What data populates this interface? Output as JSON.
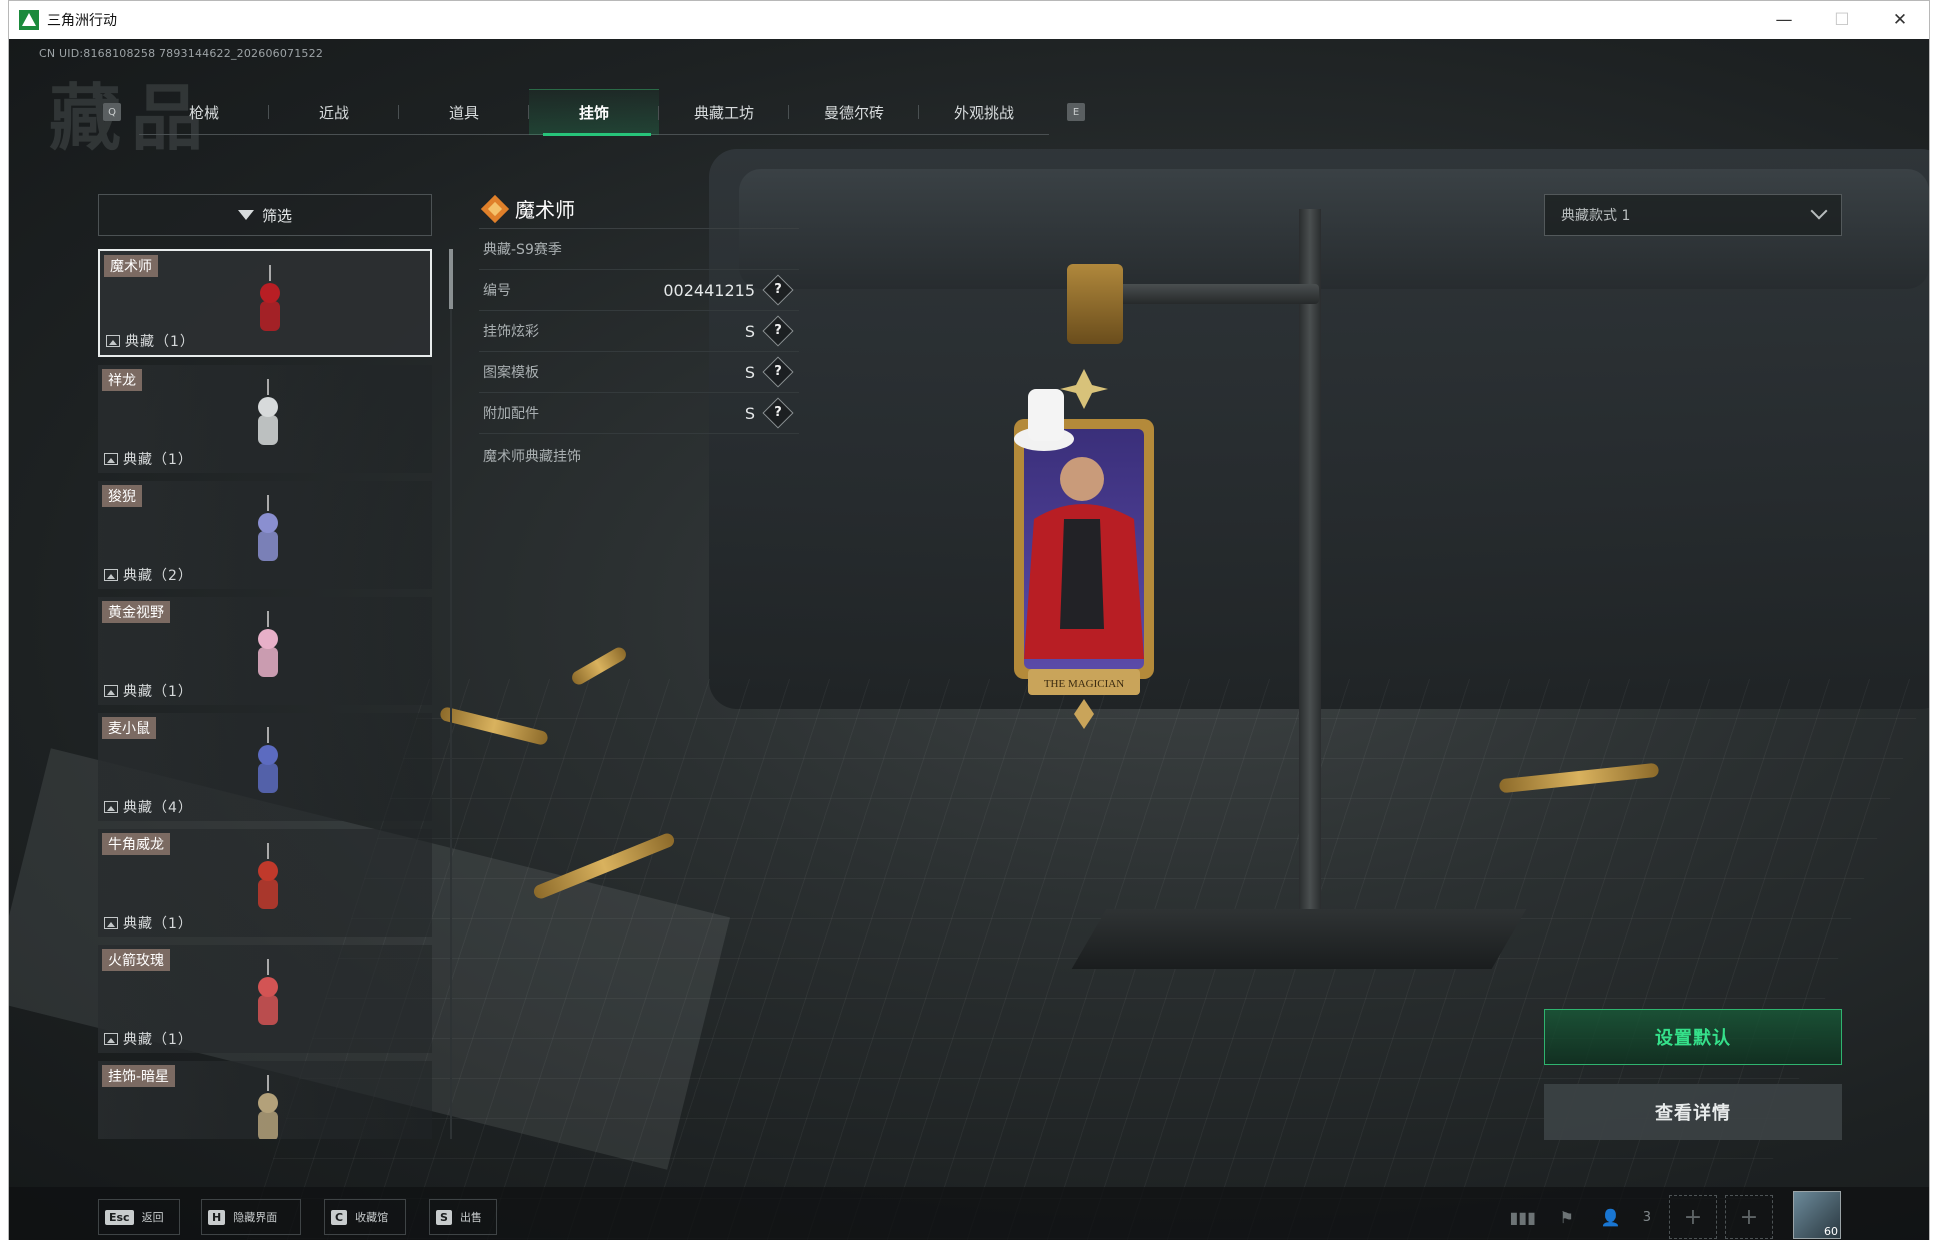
{
  "window": {
    "title": "三角洲行动",
    "controls": {
      "minimize": "—",
      "maximize": "☐",
      "close": "✕"
    }
  },
  "uid": "CN UID:8168108258 7893144622_202606071522",
  "tabs": {
    "prev_key": "Q",
    "next_key": "E",
    "items": [
      "枪械",
      "近战",
      "道具",
      "挂饰",
      "典藏工坊",
      "曼德尔砖",
      "外观挑战"
    ],
    "active": "挂饰"
  },
  "filter": {
    "label": "筛选"
  },
  "list": {
    "items": [
      {
        "name": "魔术师",
        "count": "典藏（1）",
        "selected": true
      },
      {
        "name": "祥龙",
        "count": "典藏（1）"
      },
      {
        "name": "狻猊",
        "count": "典藏（2）"
      },
      {
        "name": "黄金视野",
        "count": "典藏（1）"
      },
      {
        "name": "麦小鼠",
        "count": "典藏（4）"
      },
      {
        "name": "牛角威龙",
        "count": "典藏（1）"
      },
      {
        "name": "火箭玫瑰",
        "count": "典藏（1）"
      },
      {
        "name": "挂饰-暗星",
        "count": ""
      }
    ]
  },
  "detail": {
    "title": "魔术师",
    "season": "典藏-S9赛季",
    "rows": [
      {
        "label": "编号",
        "value": "002441215"
      },
      {
        "label": "挂饰炫彩",
        "value": "S"
      },
      {
        "label": "图案模板",
        "value": "S"
      },
      {
        "label": "附加配件",
        "value": "S"
      }
    ],
    "help": "?",
    "description": "魔术师典藏挂饰"
  },
  "style_select": {
    "value": "典藏款式 1"
  },
  "actions": {
    "set_default": "设置默认",
    "view_details": "查看详情"
  },
  "charm": {
    "banner_text": "THE MAGICIAN"
  },
  "bottom": {
    "hints": [
      {
        "key": "Esc",
        "label": "返回"
      },
      {
        "key": "H",
        "label": "隐藏界面"
      },
      {
        "key": "C",
        "label": "收藏馆"
      },
      {
        "key": "S",
        "label": "出售"
      }
    ],
    "party_count": "3",
    "avatar_level": "60"
  },
  "colors": {
    "accent_green": "#27c47a",
    "tag_bg": "#7b6a62",
    "diamond_orange": "#e0802a"
  }
}
